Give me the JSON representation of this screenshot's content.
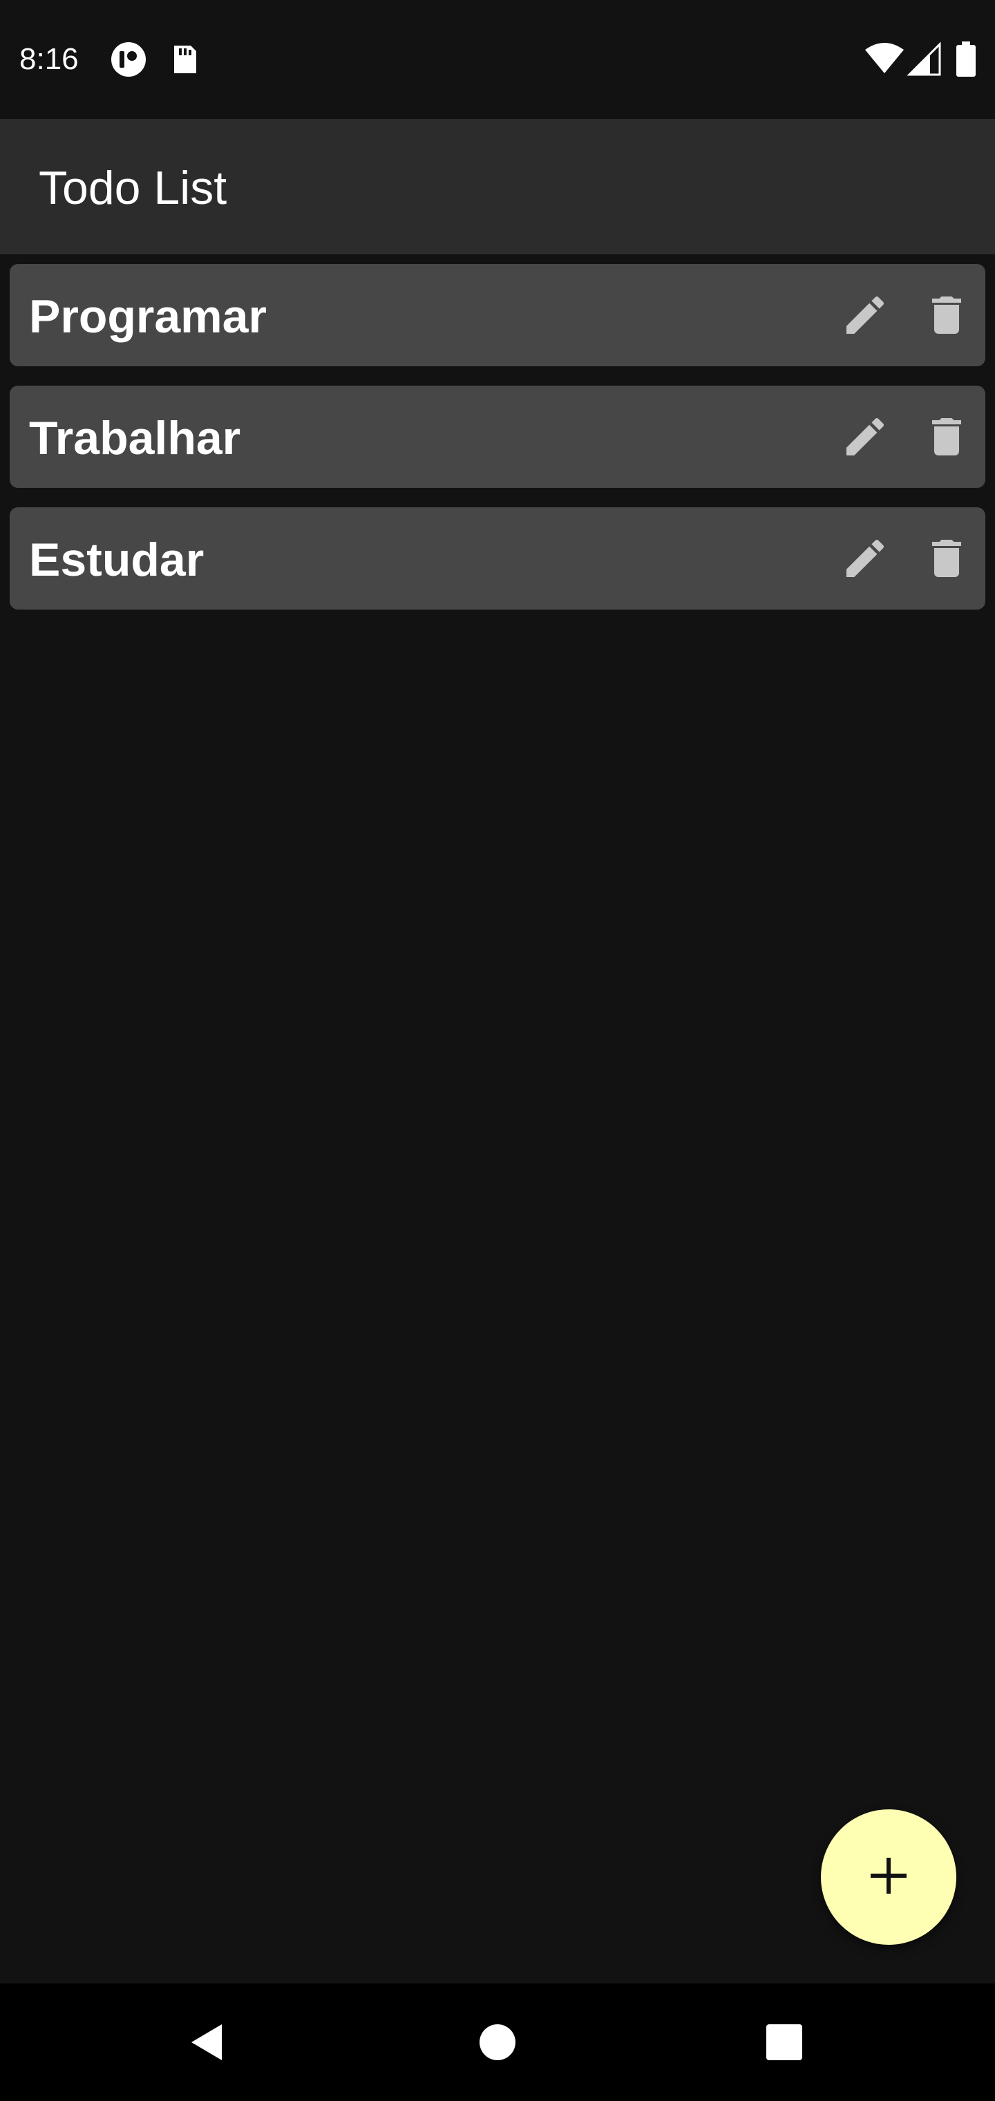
{
  "status_bar": {
    "time": "8:16",
    "left_icons": [
      "signal-app-icon",
      "sd-card-icon"
    ],
    "right_icons": [
      "wifi-icon",
      "cell-signal-icon",
      "battery-icon"
    ]
  },
  "app_bar": {
    "title": "Todo List",
    "background": "#2c2c2c"
  },
  "todos": [
    {
      "label": "Programar",
      "edit_icon": "pencil-icon",
      "delete_icon": "trash-icon"
    },
    {
      "label": "Trabalhar",
      "edit_icon": "pencil-icon",
      "delete_icon": "trash-icon"
    },
    {
      "label": "Estudar",
      "edit_icon": "pencil-icon",
      "delete_icon": "trash-icon"
    }
  ],
  "fab": {
    "icon": "plus-icon",
    "color": "#ffffb3"
  },
  "nav_bar": {
    "buttons": [
      "back-icon",
      "home-icon",
      "recents-icon"
    ]
  },
  "colors": {
    "background": "#121212",
    "item_background": "#474747",
    "icon_color": "#c8c8c8"
  }
}
